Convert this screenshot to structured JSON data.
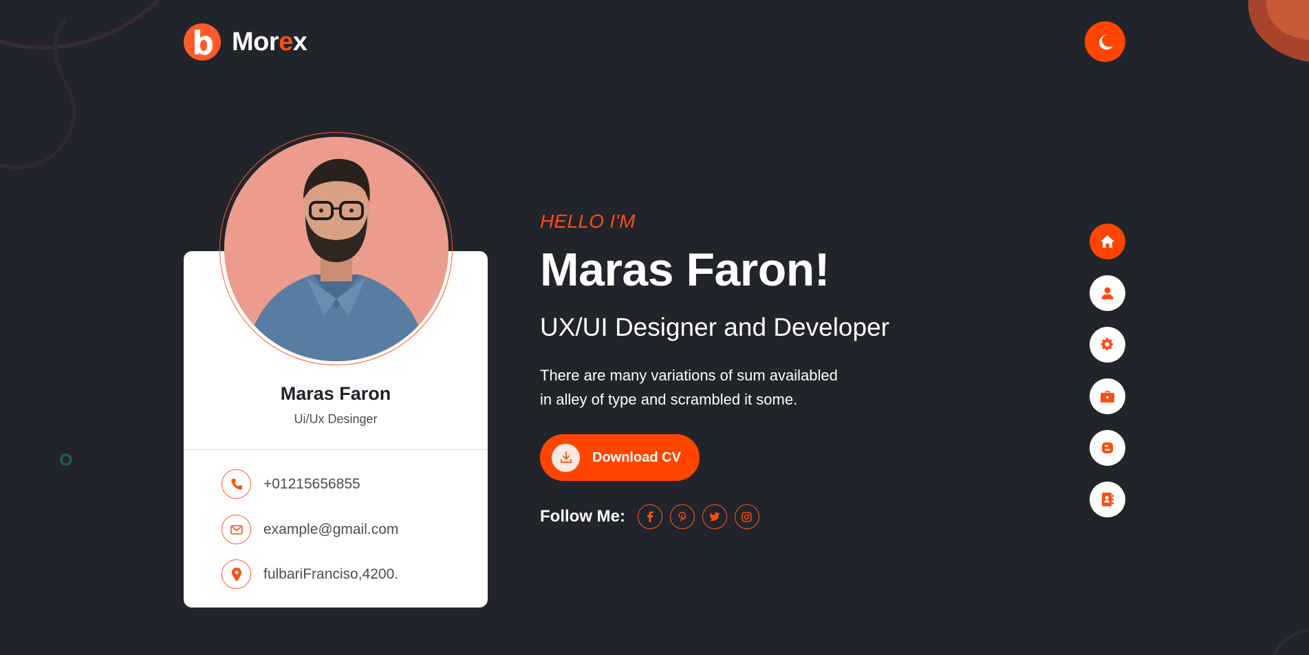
{
  "colors": {
    "accent": "#ff4500",
    "background": "#22242b",
    "card": "#ffffff"
  },
  "header": {
    "logo_letter": "b",
    "logo_text_start": "Mor",
    "logo_text_accent": "e",
    "logo_text_end": "x",
    "theme_toggle_icon": "moon-icon"
  },
  "card": {
    "name": "Maras Faron",
    "role": "Ui/Ux Desinger",
    "contacts": [
      {
        "icon": "phone-icon",
        "text": "+01215656855"
      },
      {
        "icon": "mail-icon",
        "text": "example@gmail.com"
      },
      {
        "icon": "location-icon",
        "text": "fulbariFranciso,4200."
      }
    ]
  },
  "hero": {
    "greeting": "HELLO I'M",
    "name": "Maras Faron!",
    "title": "UX/UI Designer and Developer",
    "description_line1": "There are many variations of sum availabled",
    "description_line2": "in alley of type and scrambled it some.",
    "download_label": "Download CV",
    "follow_label": "Follow Me:",
    "socials": [
      {
        "icon": "facebook-icon",
        "glyph": "f"
      },
      {
        "icon": "pinterest-icon",
        "glyph": "p"
      },
      {
        "icon": "twitter-icon",
        "glyph": "t"
      },
      {
        "icon": "instagram-icon",
        "glyph": "ig"
      }
    ]
  },
  "side_nav": [
    {
      "icon": "home-icon",
      "active": true
    },
    {
      "icon": "user-icon",
      "active": false
    },
    {
      "icon": "gear-icon",
      "active": false
    },
    {
      "icon": "briefcase-icon",
      "active": false
    },
    {
      "icon": "blog-icon",
      "active": false
    },
    {
      "icon": "contact-book-icon",
      "active": false
    }
  ]
}
